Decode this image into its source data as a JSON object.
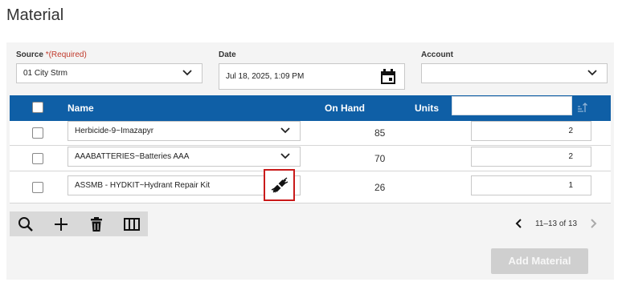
{
  "page": {
    "title": "Material"
  },
  "form": {
    "source": {
      "label": "Source",
      "required_marker": "*(Required)",
      "value": "01 City Strm"
    },
    "date": {
      "label": "Date",
      "value": "Jul 18, 2025, 1:09 PM"
    },
    "account": {
      "label": "Account",
      "value": ""
    }
  },
  "grid": {
    "columns": {
      "name": "Name",
      "on_hand": "On Hand",
      "units": "Units"
    },
    "filter_value": "",
    "rows": [
      {
        "name": "Herbicide-9~Imazapyr",
        "on_hand": "85",
        "units": "2"
      },
      {
        "name": "AAABATTERIES~Batteries AAA",
        "on_hand": "70",
        "units": "2"
      },
      {
        "name": "ASSMB - HYDKIT~Hydrant Repair Kit",
        "on_hand": "26",
        "units": "1"
      }
    ]
  },
  "toolbar": {
    "icons": [
      "search-icon",
      "add-icon",
      "delete-icon",
      "columns-icon"
    ]
  },
  "pager": {
    "range": "11–13 of 13"
  },
  "actions": {
    "add_material": "Add Material"
  },
  "colors": {
    "header": "#0f5fa6",
    "highlight": "#c91a1a",
    "required": "#c0392b"
  }
}
